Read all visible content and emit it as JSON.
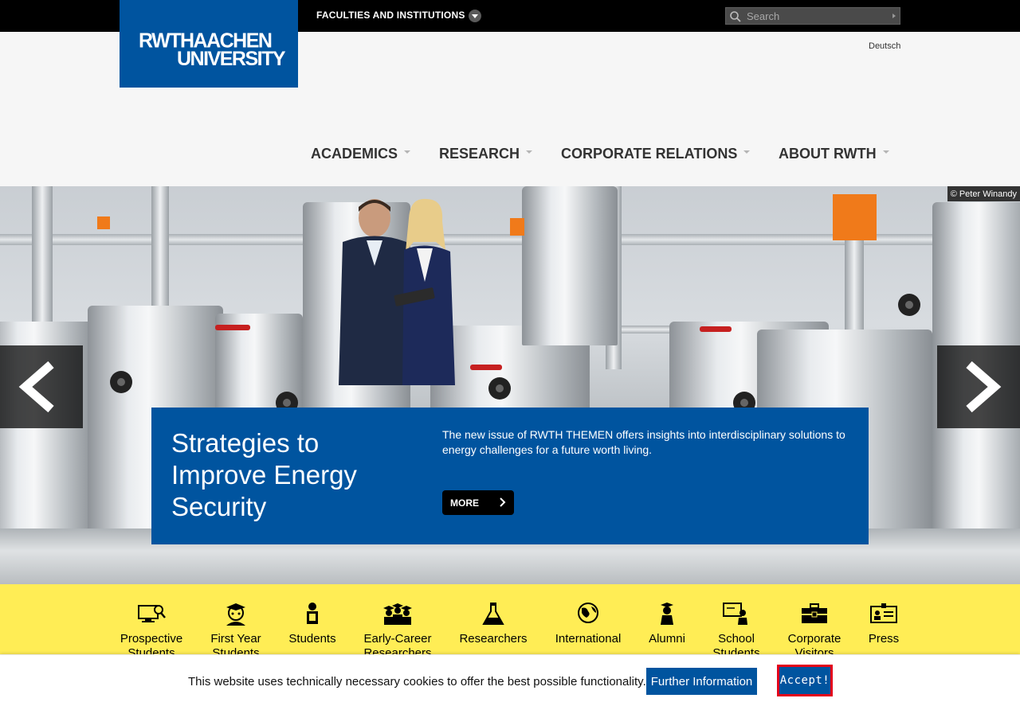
{
  "topbar": {
    "faculties_label": "FACULTIES AND INSTITUTIONS",
    "search_placeholder": "Search"
  },
  "logo": {
    "line1": "RWTHAACHEN",
    "line2": "UNIVERSITY"
  },
  "language_link": "Deutsch",
  "main_nav": [
    {
      "label": "ACADEMICS"
    },
    {
      "label": "RESEARCH"
    },
    {
      "label": "CORPORATE RELATIONS"
    },
    {
      "label": "ABOUT RWTH"
    }
  ],
  "hero": {
    "photo_credit": "© Peter Winandy",
    "title": "Strategies to Improve Energy Security",
    "text": "The new issue of RWTH THEMEN offers insights into interdisciplinary solutions to energy challenges for a future worth living.",
    "more_label": "MORE"
  },
  "audience": [
    {
      "label": "Prospective Students",
      "icon": "monitor-search-icon"
    },
    {
      "label": "First Year Students",
      "icon": "student-cap-icon"
    },
    {
      "label": "Students",
      "icon": "student-book-icon"
    },
    {
      "label": "Early-Career Researchers",
      "icon": "group-graduates-icon"
    },
    {
      "label": "Researchers",
      "icon": "flask-icon"
    },
    {
      "label": "International",
      "icon": "globe-person-icon"
    },
    {
      "label": "Alumni",
      "icon": "graduate-icon"
    },
    {
      "label": "School Students",
      "icon": "school-board-icon"
    },
    {
      "label": "Corporate Visitors",
      "icon": "briefcase-icon"
    },
    {
      "label": "Press",
      "icon": "press-card-icon"
    }
  ],
  "cookie": {
    "text": "This website uses technically necessary cookies to offer the best possible functionality.",
    "further_label": "Further Information",
    "accept_label": "Accept!"
  },
  "colors": {
    "brand_blue": "#00549f",
    "audience_yellow": "#ffed55",
    "accept_border": "#e3001b"
  }
}
